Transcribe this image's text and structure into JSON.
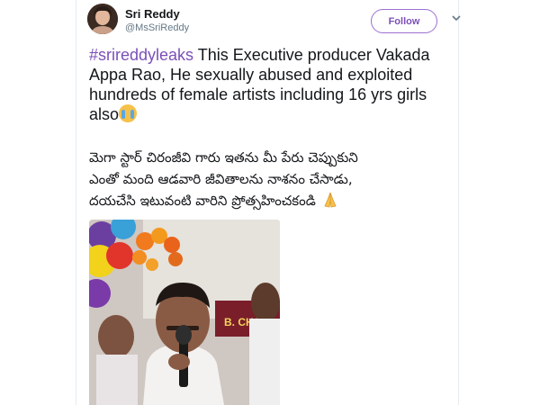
{
  "tweet": {
    "user": {
      "display_name": "Sri Reddy",
      "handle": "@MsSriReddy"
    },
    "follow_label": "Follow",
    "hashtag": "#srireddyleaks",
    "body_en": " This Executive producer Vakada Appa Rao, He sexually abused and exploited hundreds of female artists including 16 yrs girls also",
    "emoji_cry": "crying-face-icon",
    "body_te_lines": [
      "మెగా స్టార్ చిరంజీవి గారు ఇతను మీ పేరు చెప్పుకుని",
      "ఎంతో మంది ఆడవారి జీవితాలను నాశనం చేసాడు,",
      "దయచేసి ఇటువంటి వారిని ప్రోత్సహించకండి"
    ],
    "emoji_pray": "folded-hands-icon",
    "photo_banner_text": "B. CHOU"
  },
  "colors": {
    "accent": "#7b4fb8",
    "text": "#14171a",
    "muted": "#657786"
  }
}
